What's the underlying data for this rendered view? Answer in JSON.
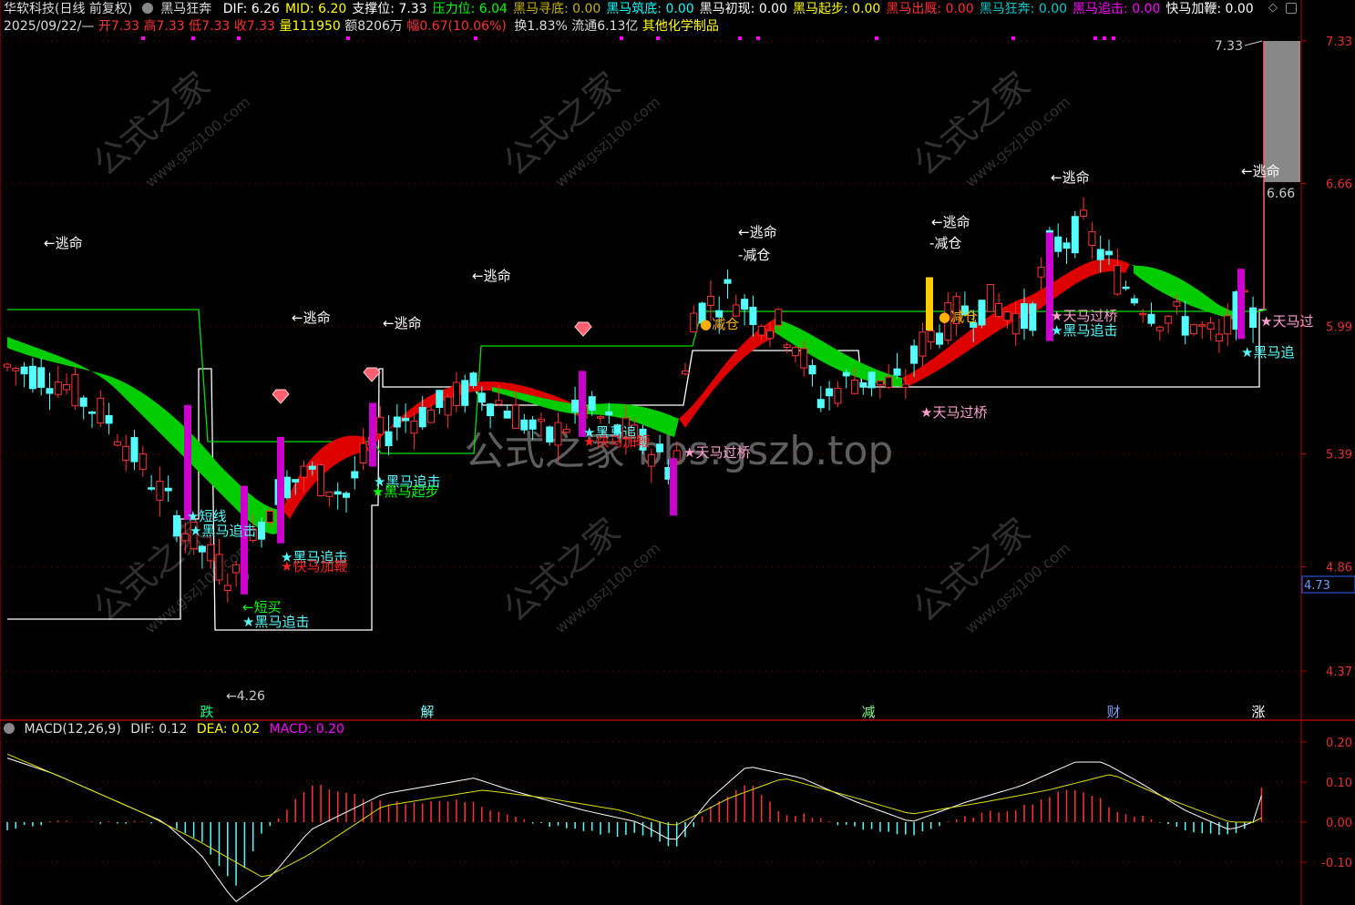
{
  "header": {
    "stock": "华软科技(日线 前复权)",
    "indicator_name": "黑马狂奔",
    "items": [
      {
        "label": "DIF: ",
        "value": "6.26",
        "color": "#ffffff"
      },
      {
        "label": "MID: ",
        "value": "6.20",
        "color": "#ffff00"
      },
      {
        "label": "支撑位: ",
        "value": "7.33",
        "color": "#ffffff"
      },
      {
        "label": "压力位: ",
        "value": "6.04",
        "color": "#00ff00"
      },
      {
        "label": "黑马寻底: ",
        "value": "0.00",
        "color": "#c8b400"
      },
      {
        "label": "黑马筑底: ",
        "value": "0.00",
        "color": "#00ffff"
      },
      {
        "label": "黑马初现: ",
        "value": "0.00",
        "color": "#ffffff"
      },
      {
        "label": "黑马起步: ",
        "value": "0.00",
        "color": "#ffff00"
      },
      {
        "label": "黑马出厩: ",
        "value": "0.00",
        "color": "#ff3030"
      },
      {
        "label": "黑马狂奔: ",
        "value": "0.00",
        "color": "#00c8c8"
      },
      {
        "label": "黑马追击: ",
        "value": "0.00",
        "color": "#ff00ff"
      },
      {
        "label": "快马加鞭: ",
        "value": "0.00",
        "color": "#ffffff"
      }
    ],
    "row2": {
      "date": "2025/09/22/—",
      "open": "开7.33",
      "high": "高7.33",
      "low": "低7.33",
      "close": "收7.33",
      "vol": "量111950",
      "amount": "额8206万",
      "change": "幅0.67(10.06%)",
      "turnover": "换1.83%",
      "float": "流通6.13亿",
      "sector": "其他化学制品"
    }
  },
  "price_axis": [
    "7.33",
    "6.66",
    "5.99",
    "5.39",
    "4.86",
    "4.37"
  ],
  "current_price_tag": "4.73",
  "price_labels": {
    "high_mark": "7.33",
    "ref_mark": "6.66",
    "low_mark": "←4.26"
  },
  "period_tags": [
    "跌",
    "解",
    "减",
    "财",
    "涨"
  ],
  "annotations": {
    "escape": "←逃命",
    "reduce": "-减仓",
    "reduce2": "●减仓",
    "chase": "★黑马追击",
    "chase_short": "★黑马追",
    "start": "★黑马起步",
    "whip": "★快马加鞭",
    "bridge": "★天马过桥",
    "bridge_short": "★天马过",
    "short_buy": "←短买",
    "short_line": "★短线"
  },
  "watermark": {
    "main": "公式之家 bbs.gszb.top",
    "logo": "公式之家",
    "url": "www.gszj100.com"
  },
  "macd": {
    "title": "MACD(12,26,9)",
    "dif_label": "DIF: ",
    "dif": "0.12",
    "dea_label": "DEA: ",
    "dea": "0.02",
    "macd_label": "MACD: ",
    "macd": "0.20",
    "axis": [
      "0.20",
      "0.10",
      "0.00",
      "-0.10"
    ]
  },
  "colors": {
    "up": "#ff3232",
    "down": "#54ffff",
    "signal": "#cc00cc",
    "ribbon_up": "#dd0000",
    "ribbon_down": "#00cc00",
    "support": "#ffffff",
    "resist": "#00dd00",
    "axis": "#b00000"
  }
}
